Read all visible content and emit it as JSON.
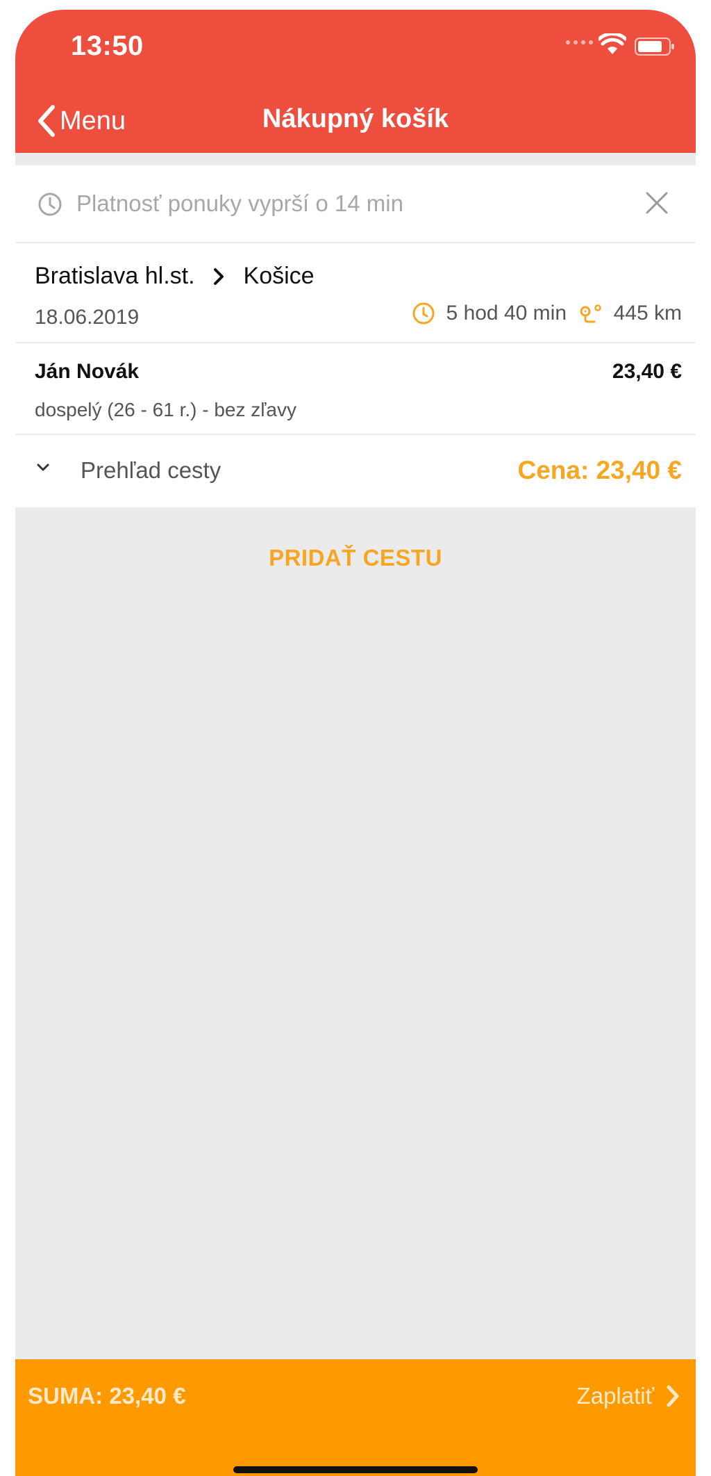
{
  "status_bar": {
    "time": "13:50"
  },
  "nav": {
    "back_label": "Menu",
    "title": "Nákupný košík"
  },
  "offer": {
    "timer_text": "Platnosť ponuky vyprší o 14 min"
  },
  "trip": {
    "from": "Bratislava hl.st.",
    "to": "Košice",
    "date": "18.06.2019",
    "duration": "5 hod 40 min",
    "distance": "445 km"
  },
  "passenger": {
    "name": "Ján Novák",
    "price": "23,40 €",
    "type": "dospelý (26 - 61 r.) - bez zľavy"
  },
  "overview": {
    "label": "Prehľad cesty",
    "price": "Cena: 23,40 €"
  },
  "actions": {
    "add_trip": "PRIDAŤ CESTU"
  },
  "footer": {
    "sum": "SUMA: 23,40 €",
    "pay_label": "Zaplatiť"
  },
  "colors": {
    "header": "#ee4e3d",
    "accent": "#f6a623",
    "footer": "#fe9a00",
    "background": "#ebebeb"
  }
}
